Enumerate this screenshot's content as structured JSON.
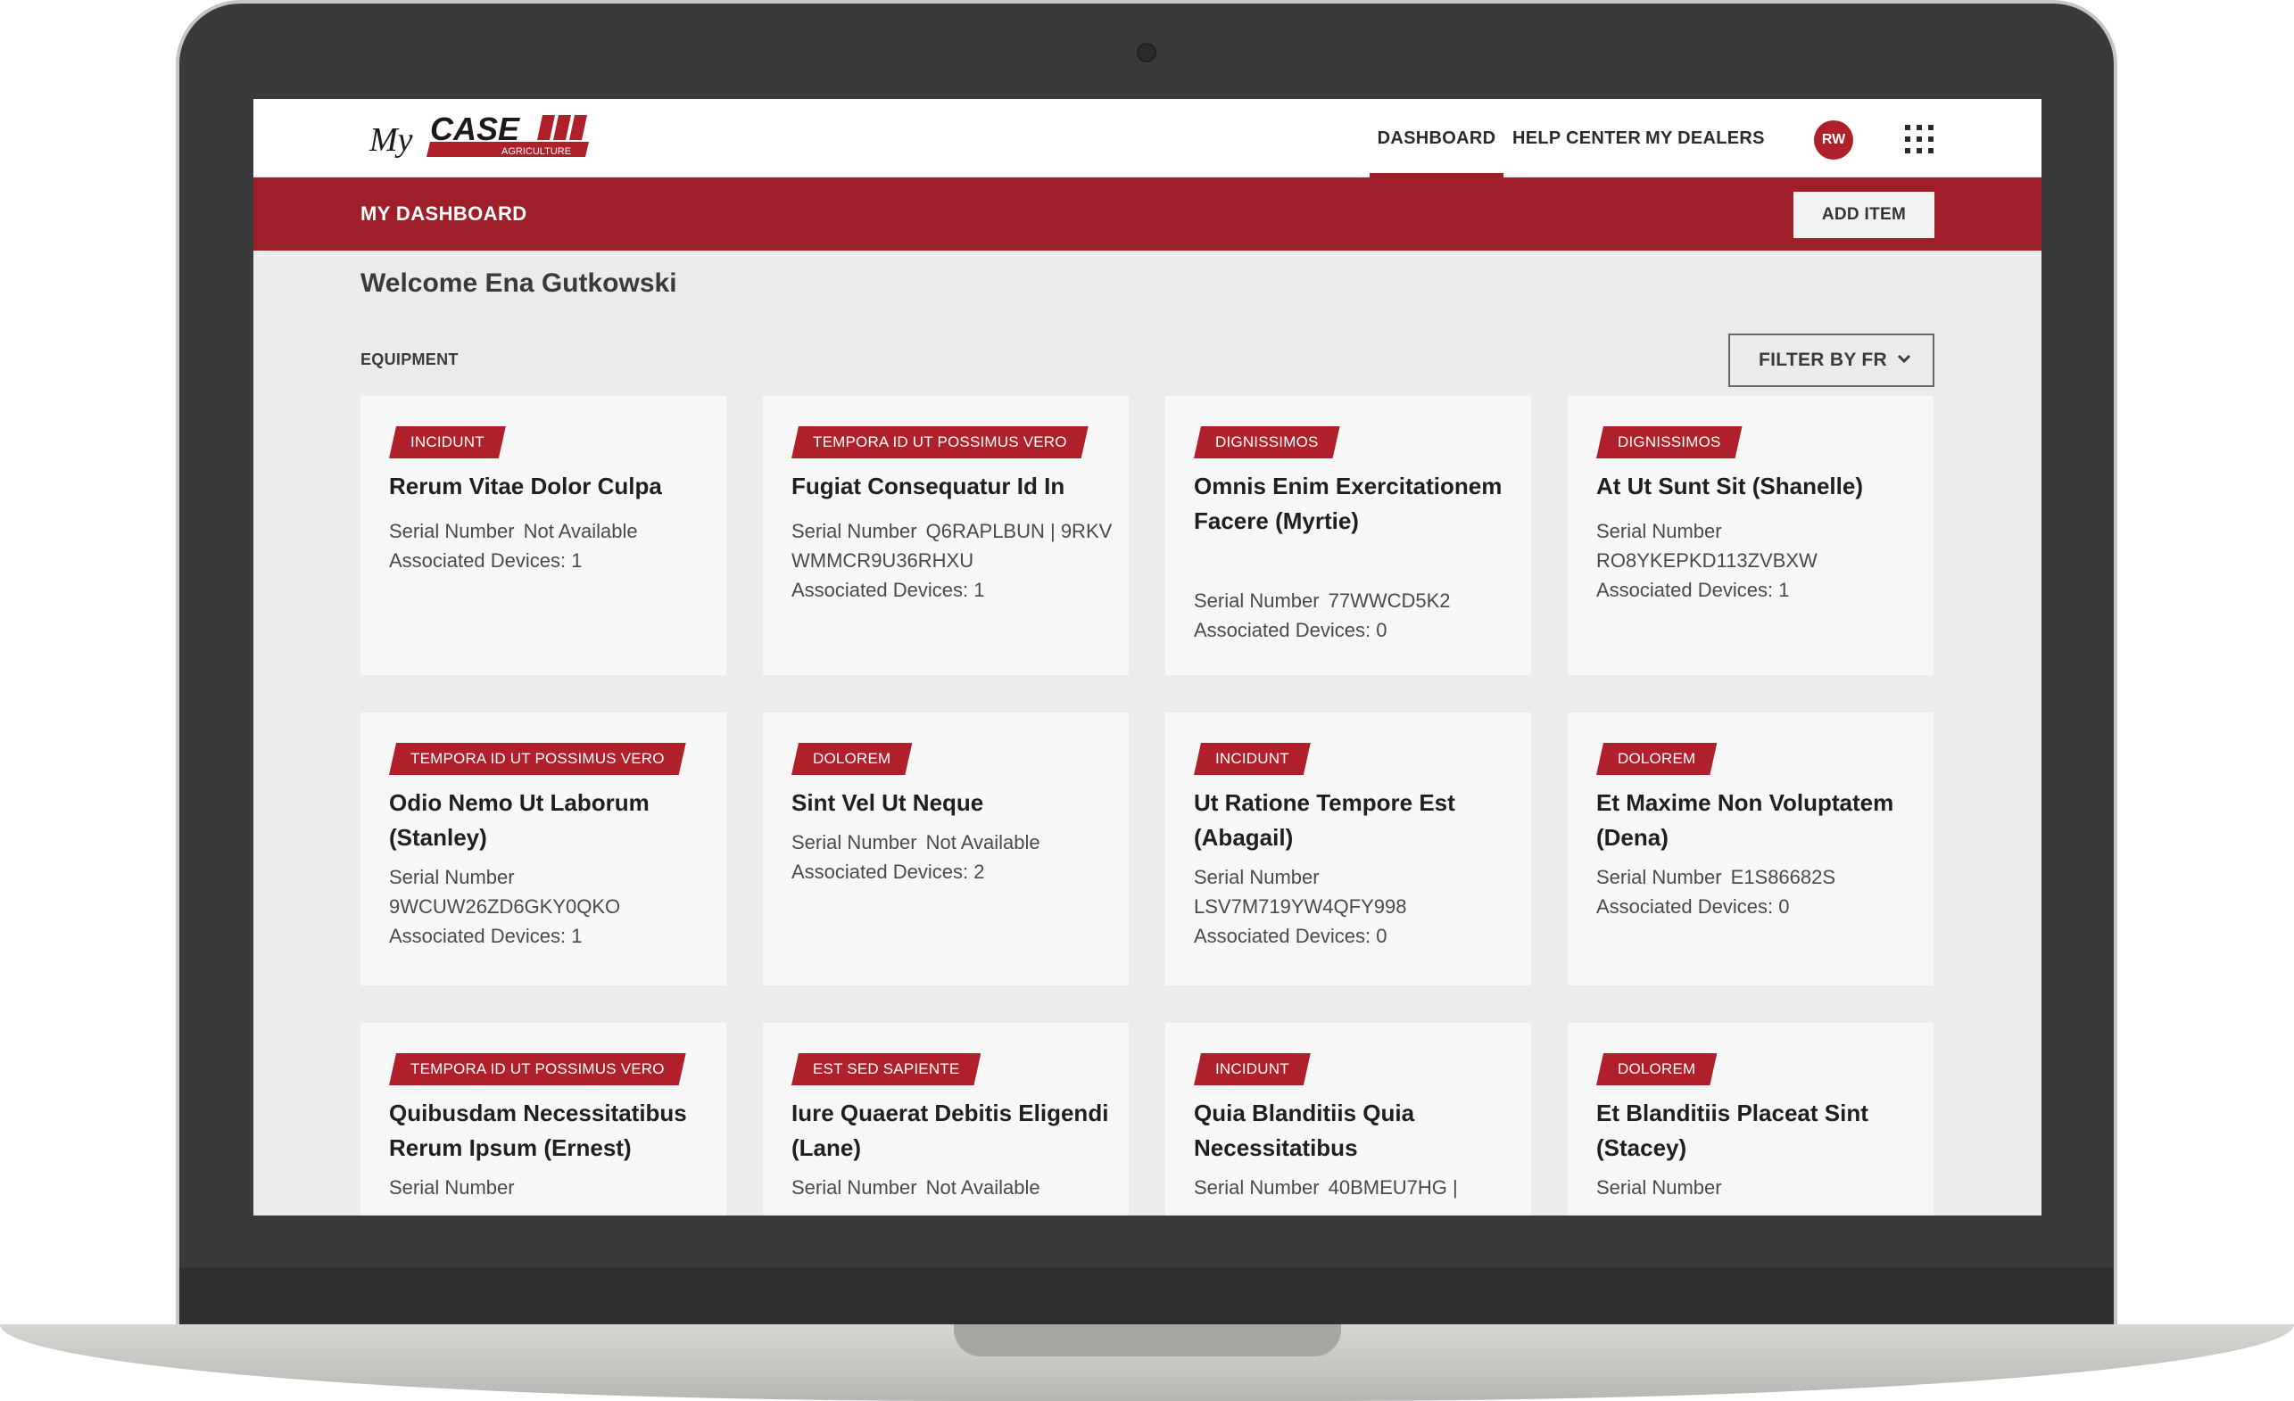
{
  "brand": {
    "logo_prefix": "My",
    "logo_name": "CASE",
    "logo_sub": "AGRICULTURE",
    "colors": {
      "primary": "#9e1f2a",
      "tag": "#b0202b",
      "background": "#ecebe9"
    }
  },
  "nav": {
    "dashboard": "DASHBOARD",
    "help_center": "HELP CENTER",
    "my_dealers": "MY DEALERS",
    "avatar_initials": "RW",
    "apps_icon": "grid-icon"
  },
  "header": {
    "title": "MY DASHBOARD",
    "add_item": "ADD ITEM"
  },
  "welcome": "Welcome Ena Gutkowski",
  "section": {
    "label": "EQUIPMENT",
    "filter": "FILTER BY FR"
  },
  "cards": [
    {
      "tag": "INCIDUNT",
      "title": "Rerum Vitae Dolor Culpa",
      "serial_label": "Serial Number",
      "serial": "Not Available",
      "devices": "Associated Devices: 1"
    },
    {
      "tag": "TEMPORA ID UT POSSIMUS VERO",
      "title": "Fugiat Consequatur Id In",
      "serial_label": "Serial Number",
      "serial": "Q6RAPLBUN | 9RKVWMMCR9U36RHXU",
      "devices": "Associated Devices: 1"
    },
    {
      "tag": "DIGNISSIMOS",
      "title": "Omnis Enim Exercitationem Facere (Myrtie)",
      "serial_label": "Serial Number",
      "serial": "77WWCD5K2",
      "devices": "Associated Devices: 0"
    },
    {
      "tag": "DIGNISSIMOS",
      "title": "At Ut Sunt Sit (Shanelle)",
      "serial_label": "Serial Number",
      "serial": "RO8YKEPKD113ZVBXW",
      "devices": "Associated Devices: 1"
    },
    {
      "tag": "TEMPORA ID UT POSSIMUS VERO",
      "title": "Odio Nemo Ut Laborum (Stanley)",
      "serial_label": "Serial Number",
      "serial": "9WCUW26ZD6GKY0QKO",
      "devices": "Associated Devices: 1"
    },
    {
      "tag": "DOLOREM",
      "title": "Sint Vel Ut Neque",
      "serial_label": "Serial Number",
      "serial": "Not Available",
      "devices": "Associated Devices: 2"
    },
    {
      "tag": "INCIDUNT",
      "title": "Ut Ratione Tempore Est (Abagail)",
      "serial_label": "Serial Number",
      "serial": "LSV7M719YW4QFY998",
      "devices": "Associated Devices: 0"
    },
    {
      "tag": "DOLOREM",
      "title": "Et Maxime Non Voluptatem (Dena)",
      "serial_label": "Serial Number",
      "serial": "E1S86682S",
      "devices": "Associated Devices: 0"
    },
    {
      "tag": "TEMPORA ID UT POSSIMUS VERO",
      "title": "Quibusdam Necessitatibus Rerum Ipsum (Ernest)",
      "serial_label": "Serial Number",
      "serial": "",
      "devices": ""
    },
    {
      "tag": "EST SED SAPIENTE",
      "title": "Iure Quaerat Debitis Eligendi (Lane)",
      "serial_label": "Serial Number",
      "serial": "Not Available",
      "devices": ""
    },
    {
      "tag": "INCIDUNT",
      "title": "Quia Blanditiis Quia Necessitatibus",
      "serial_label": "Serial Number",
      "serial": "40BMEU7HG |",
      "devices": ""
    },
    {
      "tag": "DOLOREM",
      "title": "Et Blanditiis Placeat Sint (Stacey)",
      "serial_label": "Serial Number",
      "serial": "",
      "devices": ""
    }
  ]
}
